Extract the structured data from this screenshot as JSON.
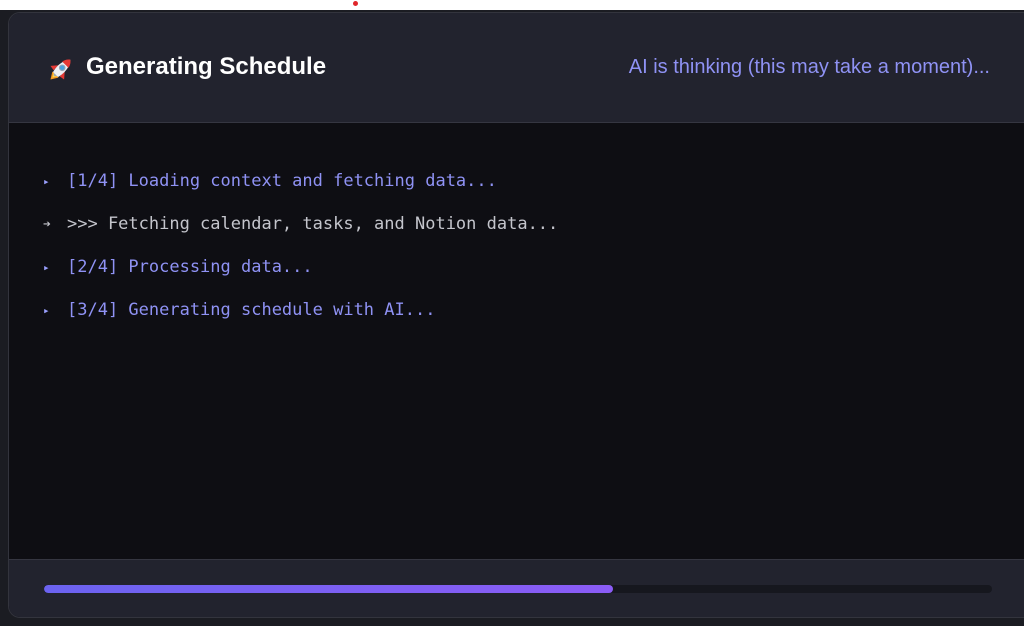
{
  "header": {
    "icon": "rocket-icon",
    "title": "Generating Schedule",
    "status": "AI is thinking (this may take a moment)..."
  },
  "log": {
    "lines": [
      {
        "kind": "step",
        "marker": "▸",
        "text": "[1/4] Loading context and fetching data..."
      },
      {
        "kind": "info",
        "marker": "➔",
        "text": ">>> Fetching calendar, tasks, and Notion data..."
      },
      {
        "kind": "step",
        "marker": "▸",
        "text": "[2/4] Processing data..."
      },
      {
        "kind": "step",
        "marker": "▸",
        "text": "[3/4] Generating schedule with AI..."
      }
    ]
  },
  "progress": {
    "fraction": 0.6
  },
  "colors": {
    "accent": "#8f92f4",
    "progress_start": "#6c63f0",
    "progress_end": "#8b5cf6",
    "header_bg": "#22232e",
    "log_bg": "#0e0e13",
    "notification_dot": "#e0262a"
  }
}
